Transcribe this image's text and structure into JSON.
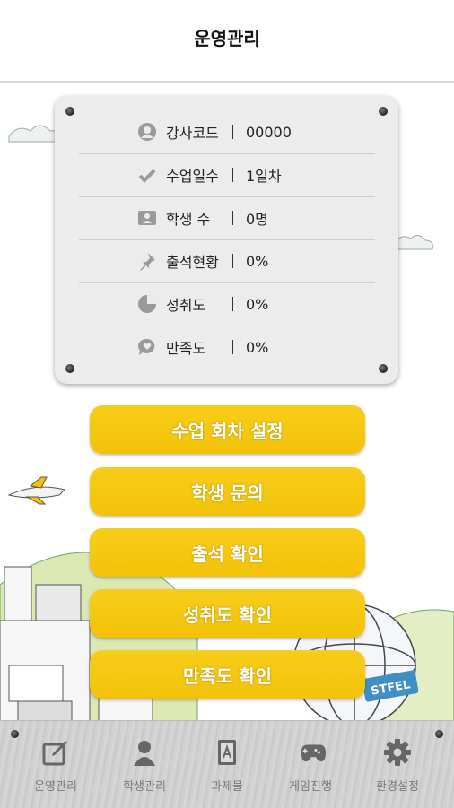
{
  "header": {
    "title": "운영관리"
  },
  "info": {
    "rows": [
      {
        "icon": "user-icon",
        "label": "강사코드",
        "value": "00000"
      },
      {
        "icon": "check-icon",
        "label": "수업일수",
        "value": "1일차"
      },
      {
        "icon": "students-icon",
        "label": "학생 수",
        "value": "0명"
      },
      {
        "icon": "pin-icon",
        "label": "출석현황",
        "value": "0%"
      },
      {
        "icon": "pie-icon",
        "label": "성취도",
        "value": "0%"
      },
      {
        "icon": "heart-chat-icon",
        "label": "만족도",
        "value": "0%"
      }
    ]
  },
  "buttons": {
    "session": "수업 회차 설정",
    "inquiry": "학생 문의",
    "attendance": "출석 확인",
    "achievement": "성취도 확인",
    "satisfaction": "만족도 확인"
  },
  "background": {
    "sign_text": "STFEL"
  },
  "tabs": [
    {
      "icon": "edit-icon",
      "label": "운영관리"
    },
    {
      "icon": "person-icon",
      "label": "학생관리"
    },
    {
      "icon": "book-icon",
      "label": "과제물"
    },
    {
      "icon": "gamepad-icon",
      "label": "게임진행"
    },
    {
      "icon": "gear-icon",
      "label": "환경설정"
    }
  ],
  "colors": {
    "accent": "#f5c60d",
    "tab_icon": "#666666"
  }
}
